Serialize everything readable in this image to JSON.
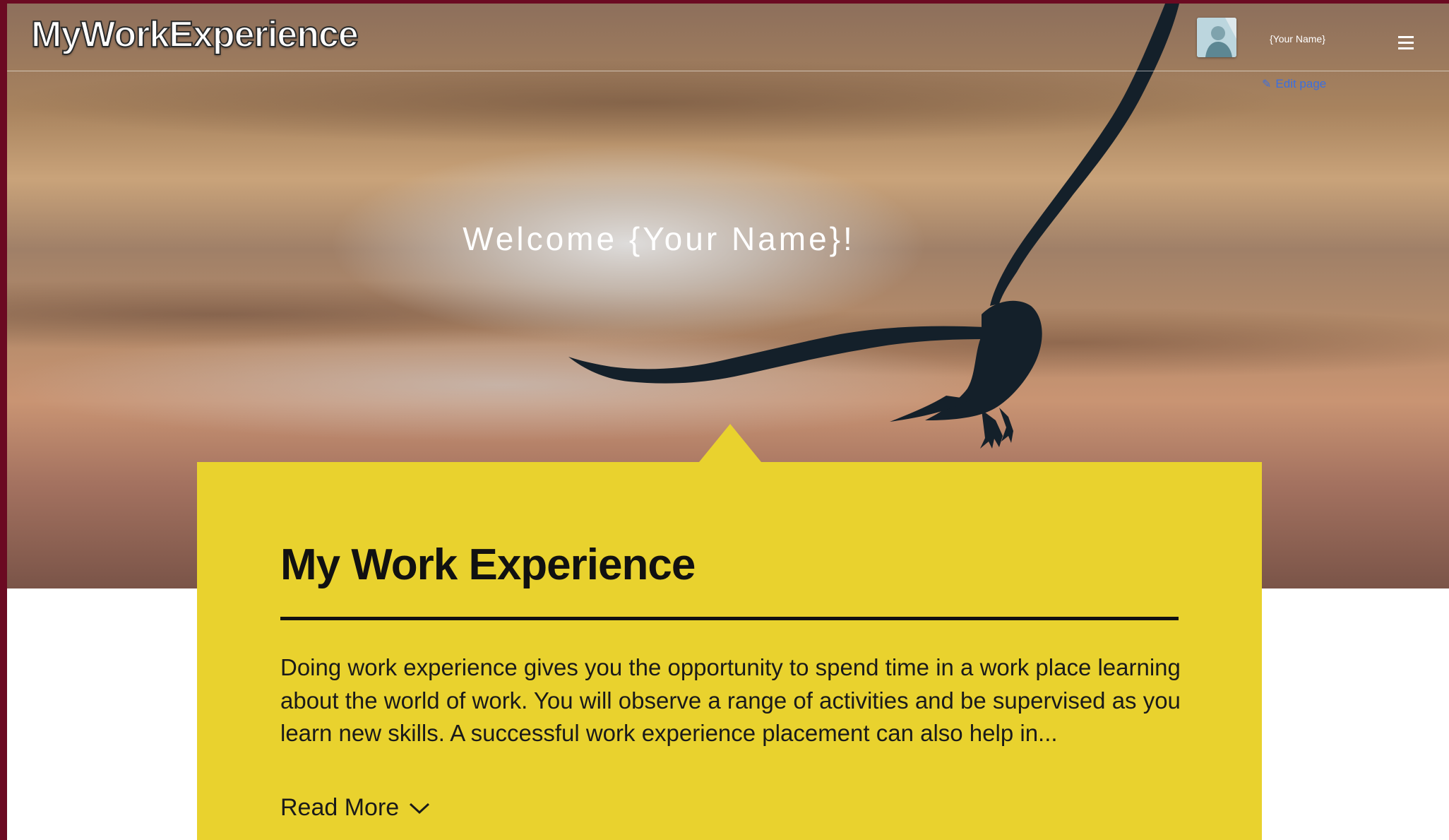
{
  "header": {
    "brand": "MyWorkExperience",
    "user_name": "{Your Name}",
    "edit_label": "Edit page",
    "menu_icon": "hamburger-menu-icon",
    "avatar_icon": "user-avatar-icon"
  },
  "hero": {
    "welcome": "Welcome {Your Name}!"
  },
  "card": {
    "title": "My Work Experience",
    "body": "Doing work experience gives you the opportunity to spend time in a work place learning about the world of work. You will observe a range of activities and be supervised as you learn new skills. A successful work experience placement can also help in...",
    "read_more": "Read More",
    "read_more_icon": "chevron-down-icon"
  },
  "colors": {
    "frame_border": "#6b0a22",
    "card_bg": "#e9d22e",
    "link": "#3b6fe0"
  }
}
